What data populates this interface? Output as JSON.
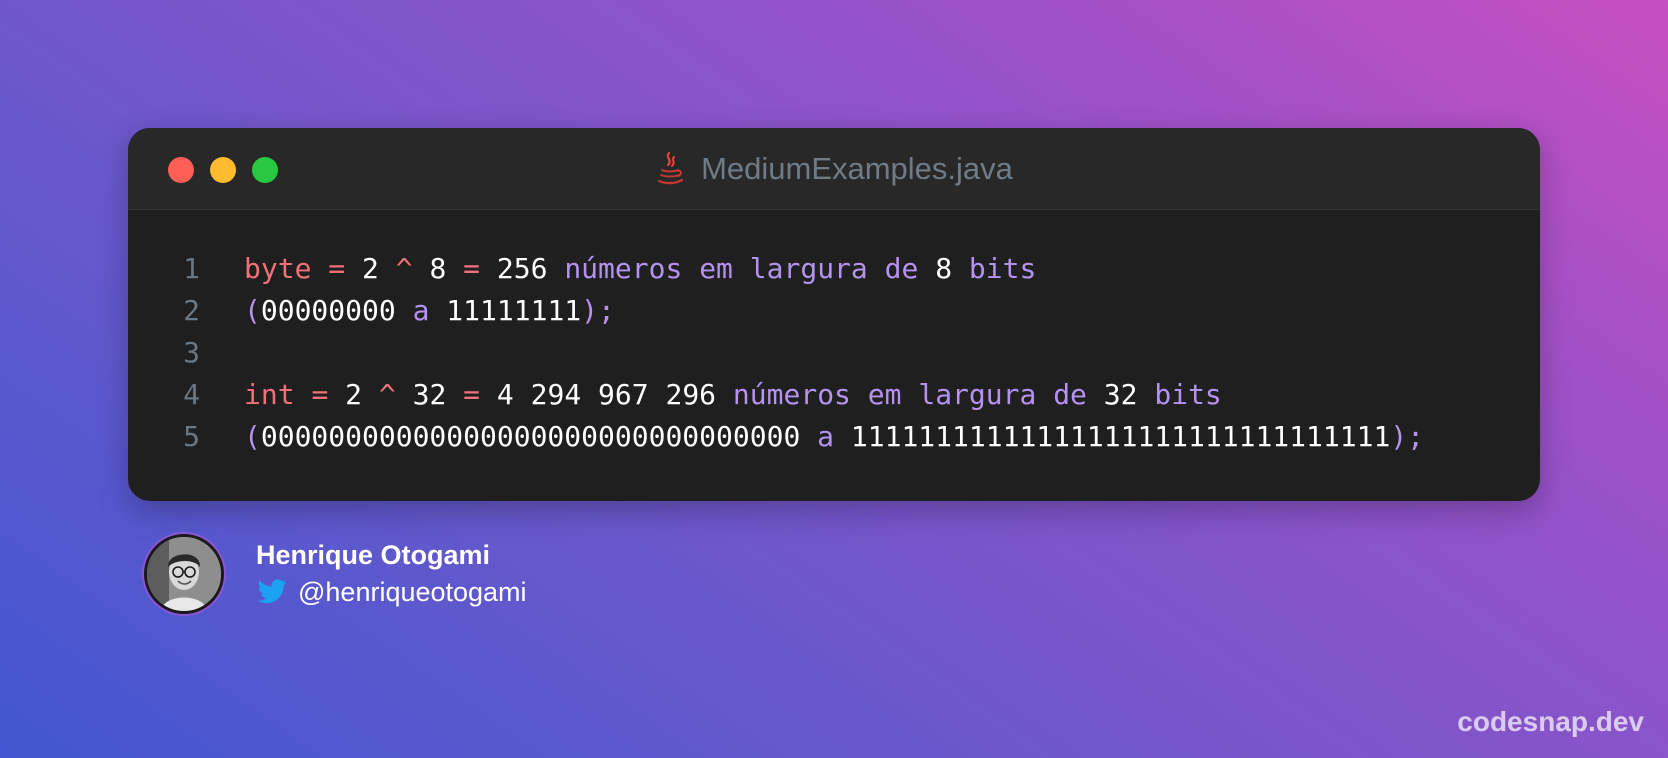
{
  "window": {
    "title": "MediumExamples.java",
    "file_icon": "java-icon",
    "controls": [
      "close",
      "minimize",
      "maximize"
    ]
  },
  "code": {
    "lines": [
      {
        "number": "1",
        "tokens": [
          {
            "text": "byte",
            "type": "kw"
          },
          {
            "text": " ",
            "type": "ws"
          },
          {
            "text": "=",
            "type": "op"
          },
          {
            "text": " ",
            "type": "ws"
          },
          {
            "text": "2",
            "type": "num"
          },
          {
            "text": " ",
            "type": "ws"
          },
          {
            "text": "^",
            "type": "op"
          },
          {
            "text": " ",
            "type": "ws"
          },
          {
            "text": "8",
            "type": "num"
          },
          {
            "text": " ",
            "type": "ws"
          },
          {
            "text": "=",
            "type": "op"
          },
          {
            "text": " ",
            "type": "ws"
          },
          {
            "text": "256",
            "type": "num"
          },
          {
            "text": " ",
            "type": "ws"
          },
          {
            "text": "números em largura de",
            "type": "txt"
          },
          {
            "text": " ",
            "type": "ws"
          },
          {
            "text": "8",
            "type": "num"
          },
          {
            "text": " ",
            "type": "ws"
          },
          {
            "text": "bits",
            "type": "txt"
          }
        ]
      },
      {
        "number": "2",
        "tokens": [
          {
            "text": "(",
            "type": "pn"
          },
          {
            "text": "00000000",
            "type": "num"
          },
          {
            "text": " ",
            "type": "ws"
          },
          {
            "text": "a",
            "type": "txt"
          },
          {
            "text": " ",
            "type": "ws"
          },
          {
            "text": "11111111",
            "type": "num"
          },
          {
            "text": ");",
            "type": "pn"
          }
        ]
      },
      {
        "number": "3",
        "tokens": []
      },
      {
        "number": "4",
        "tokens": [
          {
            "text": "int",
            "type": "kw"
          },
          {
            "text": " ",
            "type": "ws"
          },
          {
            "text": "=",
            "type": "op"
          },
          {
            "text": " ",
            "type": "ws"
          },
          {
            "text": "2",
            "type": "num"
          },
          {
            "text": " ",
            "type": "ws"
          },
          {
            "text": "^",
            "type": "op"
          },
          {
            "text": " ",
            "type": "ws"
          },
          {
            "text": "32",
            "type": "num"
          },
          {
            "text": " ",
            "type": "ws"
          },
          {
            "text": "=",
            "type": "op"
          },
          {
            "text": " ",
            "type": "ws"
          },
          {
            "text": "4 294 967 296",
            "type": "num"
          },
          {
            "text": " ",
            "type": "ws"
          },
          {
            "text": "números em largura de",
            "type": "txt"
          },
          {
            "text": " ",
            "type": "ws"
          },
          {
            "text": "32",
            "type": "num"
          },
          {
            "text": " ",
            "type": "ws"
          },
          {
            "text": "bits",
            "type": "txt"
          }
        ]
      },
      {
        "number": "5",
        "tokens": [
          {
            "text": "(",
            "type": "pn"
          },
          {
            "text": "00000000000000000000000000000000",
            "type": "num"
          },
          {
            "text": " ",
            "type": "ws"
          },
          {
            "text": "a",
            "type": "txt"
          },
          {
            "text": " ",
            "type": "ws"
          },
          {
            "text": "11111111111111111111111111111111",
            "type": "num"
          },
          {
            "text": ");",
            "type": "pn"
          }
        ]
      }
    ]
  },
  "author": {
    "name": "Henrique Otogami",
    "handle": "@henriqueotogami",
    "handle_icon": "twitter-icon"
  },
  "branding": "codesnap.dev",
  "colors": {
    "keyword": "#f07178",
    "text": "#b392f0",
    "number": "#ffffff",
    "line_number": "#6a7680",
    "editor_bg": "#1f1f1f",
    "twitter": "#1da1f2"
  }
}
